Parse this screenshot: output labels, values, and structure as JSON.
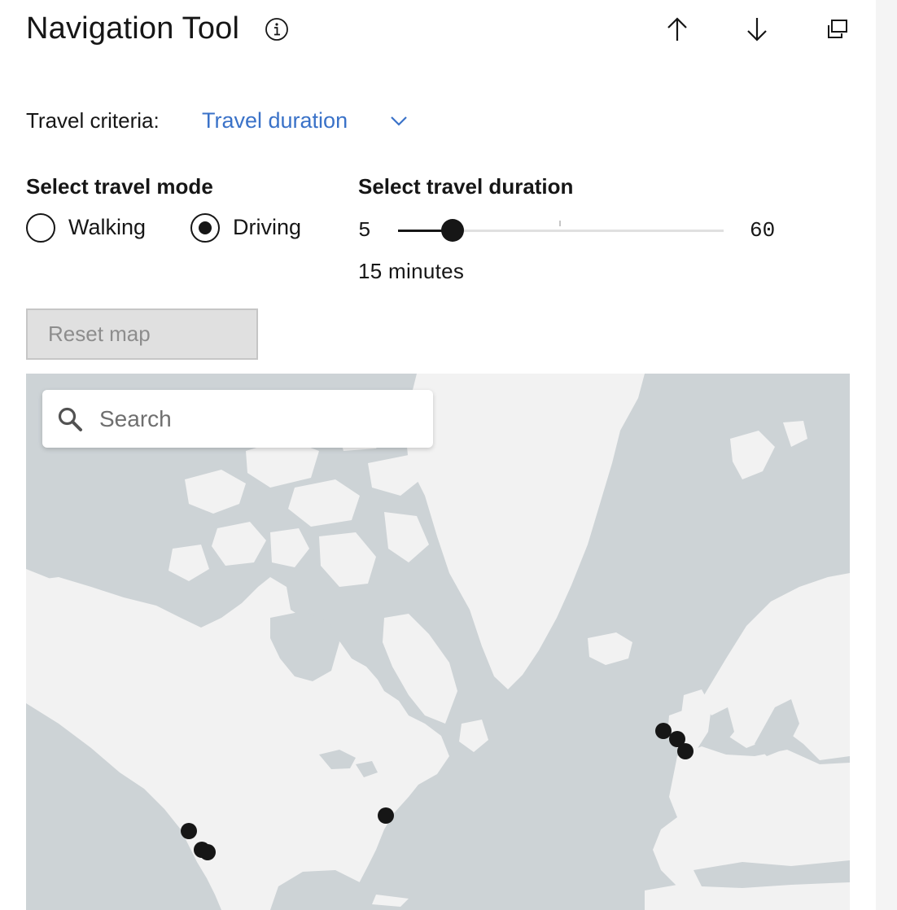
{
  "header": {
    "title": "Navigation Tool",
    "icons": [
      "info-icon",
      "arrow-up-icon",
      "arrow-down-icon",
      "popout-icon"
    ]
  },
  "criteria": {
    "label": "Travel criteria:",
    "selected": "Travel duration"
  },
  "travel_mode": {
    "heading": "Select travel mode",
    "options": [
      {
        "label": "Walking",
        "checked": false
      },
      {
        "label": "Driving",
        "checked": true
      }
    ]
  },
  "duration": {
    "heading": "Select travel duration",
    "min": "5",
    "max": "60",
    "value": 15,
    "value_label": "15 minutes"
  },
  "reset": {
    "label": "Reset map"
  },
  "map": {
    "search_placeholder": "Search",
    "colors": {
      "water": "#cdd3d6",
      "land": "#f2f2f2",
      "marker": "#161616"
    },
    "markers": [
      {
        "name": "marker-san-francisco"
      },
      {
        "name": "marker-los-angeles-1"
      },
      {
        "name": "marker-los-angeles-2"
      },
      {
        "name": "marker-new-york"
      },
      {
        "name": "marker-dublin"
      },
      {
        "name": "marker-manchester"
      },
      {
        "name": "marker-london"
      }
    ]
  },
  "colors": {
    "accent": "#3a72c8",
    "text": "#161616",
    "disabled_bg": "#e0e0e0",
    "disabled_text": "#8d8d8d"
  }
}
